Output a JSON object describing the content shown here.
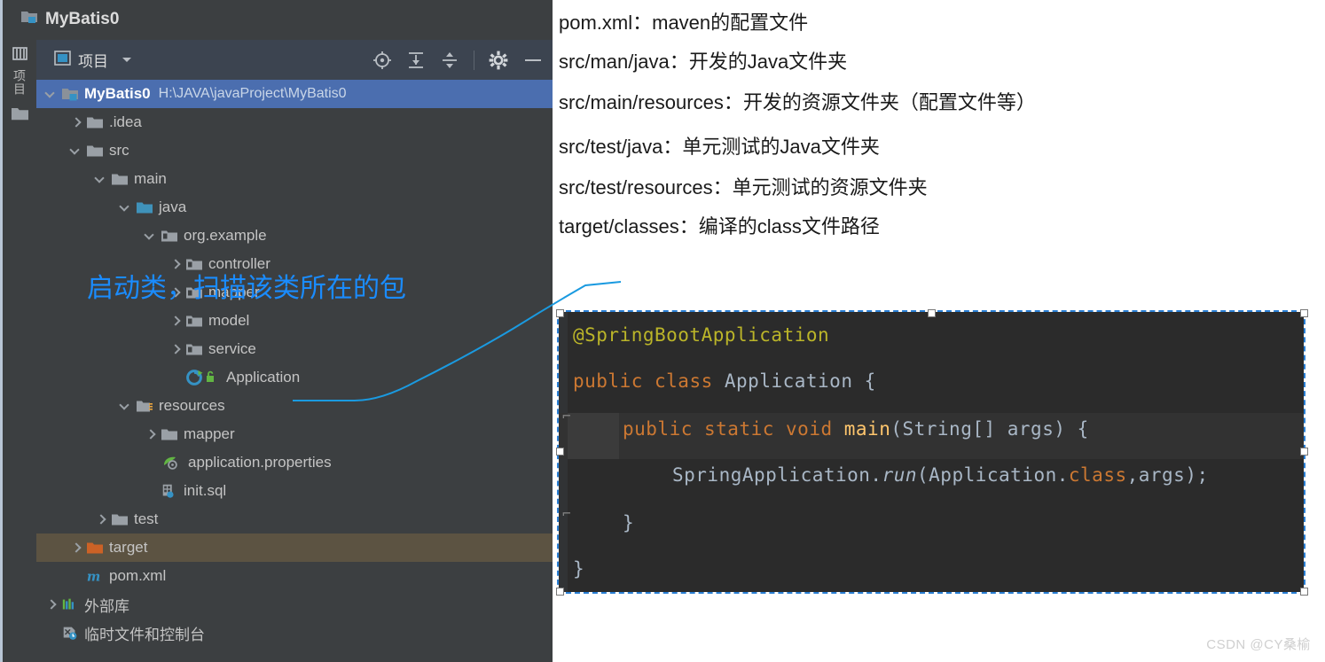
{
  "ide": {
    "window_title": "MyBatis0",
    "toolstrip": {
      "project_tab_label": "项目",
      "folder_icon": "folder-icon"
    },
    "toolbar": {
      "title": "项目",
      "dropdown_icon": "chevron-down-icon",
      "icons": [
        {
          "name": "locate-target-icon",
          "tooltip": "选择打开文件"
        },
        {
          "name": "expand-all-icon",
          "tooltip": "全部展开"
        },
        {
          "name": "collapse-all-icon",
          "tooltip": "全部折叠"
        },
        {
          "name": "settings-gear-icon",
          "tooltip": "设置"
        },
        {
          "name": "minimize-icon",
          "tooltip": "隐藏"
        }
      ]
    },
    "tree": [
      {
        "label": "MyBatis0",
        "path": "H:\\JAVA\\javaProject\\MyBatis0",
        "depth": 0,
        "arrow": "down",
        "icon": "module-icon",
        "state": "selected"
      },
      {
        "label": ".idea",
        "path": "",
        "depth": 1,
        "arrow": "right",
        "icon": "folder-icon",
        "state": "none"
      },
      {
        "label": "src",
        "path": "",
        "depth": 1,
        "arrow": "down",
        "icon": "folder-icon",
        "state": "none"
      },
      {
        "label": "main",
        "path": "",
        "depth": 2,
        "arrow": "down",
        "icon": "folder-icon",
        "state": "none"
      },
      {
        "label": "java",
        "path": "",
        "depth": 3,
        "arrow": "down",
        "icon": "source-root-icon",
        "state": "none"
      },
      {
        "label": "org.example",
        "path": "",
        "depth": 4,
        "arrow": "down",
        "icon": "package-icon",
        "state": "none"
      },
      {
        "label": "controller",
        "path": "",
        "depth": 5,
        "arrow": "right",
        "icon": "package-icon",
        "state": "none"
      },
      {
        "label": "mapper",
        "path": "",
        "depth": 5,
        "arrow": "right",
        "icon": "package-icon",
        "state": "none"
      },
      {
        "label": "model",
        "path": "",
        "depth": 5,
        "arrow": "right",
        "icon": "package-icon",
        "state": "none"
      },
      {
        "label": "service",
        "path": "",
        "depth": 5,
        "arrow": "right",
        "icon": "package-icon",
        "state": "none"
      },
      {
        "label": "Application",
        "path": "",
        "depth": 5,
        "arrow": "none",
        "icon": "java-class-runnable-icon",
        "state": "none"
      },
      {
        "label": "resources",
        "path": "",
        "depth": 3,
        "arrow": "down",
        "icon": "resource-root-icon",
        "state": "none"
      },
      {
        "label": "mapper",
        "path": "",
        "depth": 4,
        "arrow": "right",
        "icon": "folder-icon",
        "state": "none"
      },
      {
        "label": "application.properties",
        "path": "",
        "depth": 4,
        "arrow": "none",
        "icon": "spring-properties-icon",
        "state": "none"
      },
      {
        "label": "init.sql",
        "path": "",
        "depth": 4,
        "arrow": "none",
        "icon": "sql-file-icon",
        "state": "none"
      },
      {
        "label": "test",
        "path": "",
        "depth": 2,
        "arrow": "right",
        "icon": "folder-icon",
        "state": "none"
      },
      {
        "label": "target",
        "path": "",
        "depth": 1,
        "arrow": "right",
        "icon": "excluded-folder-icon",
        "state": "highlighted"
      },
      {
        "label": "pom.xml",
        "path": "",
        "depth": 1,
        "arrow": "none",
        "icon": "maven-file-icon",
        "state": "none"
      },
      {
        "label": "外部库",
        "path": "",
        "depth": 0,
        "arrow": "right",
        "icon": "external-libraries-icon",
        "state": "none"
      },
      {
        "label": "临时文件和控制台",
        "path": "",
        "depth": 0,
        "arrow": "none",
        "icon": "scratches-consoles-icon",
        "state": "none"
      }
    ]
  },
  "notes": {
    "lines": [
      "pom.xml：maven的配置文件",
      "src/man/java：开发的Java文件夹",
      "src/main/resources：开发的资源文件夹（配置文件等）",
      "src/test/java：单元测试的Java文件夹",
      "src/test/resources：单元测试的资源文件夹",
      "target/classes：编译的class文件路径"
    ],
    "callout": "启动类，扫描该类所在的包",
    "callout_color": "#1a8cff"
  },
  "code": {
    "language": "java",
    "lines": [
      {
        "indent": 0,
        "tokens": [
          {
            "t": "@SpringBootApplication",
            "c": "anno"
          }
        ]
      },
      {
        "indent": 0,
        "tokens": [
          {
            "t": "public",
            "c": "k"
          },
          {
            "t": " ",
            "c": "pun"
          },
          {
            "t": "class",
            "c": "k"
          },
          {
            "t": " ",
            "c": "pun"
          },
          {
            "t": "Application",
            "c": "typ"
          },
          {
            "t": " {",
            "c": "pun"
          }
        ]
      },
      {
        "indent": 1,
        "tokens": [
          {
            "t": "public",
            "c": "k"
          },
          {
            "t": " ",
            "c": "pun"
          },
          {
            "t": "static",
            "c": "k"
          },
          {
            "t": " ",
            "c": "pun"
          },
          {
            "t": "void",
            "c": "k"
          },
          {
            "t": " ",
            "c": "pun"
          },
          {
            "t": "main",
            "c": "mth"
          },
          {
            "t": "(String[] args) {",
            "c": "pun"
          }
        ]
      },
      {
        "indent": 2,
        "tokens": [
          {
            "t": "SpringApplication.",
            "c": "typ"
          },
          {
            "t": "run",
            "c": "itl"
          },
          {
            "t": "(Application.",
            "c": "pun"
          },
          {
            "t": "class",
            "c": "k"
          },
          {
            "t": ",args);",
            "c": "pun"
          }
        ]
      },
      {
        "indent": 1,
        "tokens": [
          {
            "t": "}",
            "c": "pun"
          }
        ]
      },
      {
        "indent": 0,
        "tokens": [
          {
            "t": "}",
            "c": "pun"
          }
        ]
      }
    ],
    "raw": "@SpringBootApplication\npublic class Application {\n    public static void main(String[] args) {\n        SpringApplication.run(Application.class,args);\n    }\n}"
  },
  "watermark": "CSDN @CY桑榆",
  "colors": {
    "ide_background": "#3c3f41",
    "toolbar_background": "#3c4450",
    "selection_blue": "#4b6eaf",
    "excluded_highlight": "#5c5342",
    "code_background": "#2b2b2b",
    "callout_blue": "#1a8cff",
    "annotation_yellow": "#bbb529",
    "keyword_orange": "#cc7832",
    "method_yellow": "#ffc66d"
  }
}
